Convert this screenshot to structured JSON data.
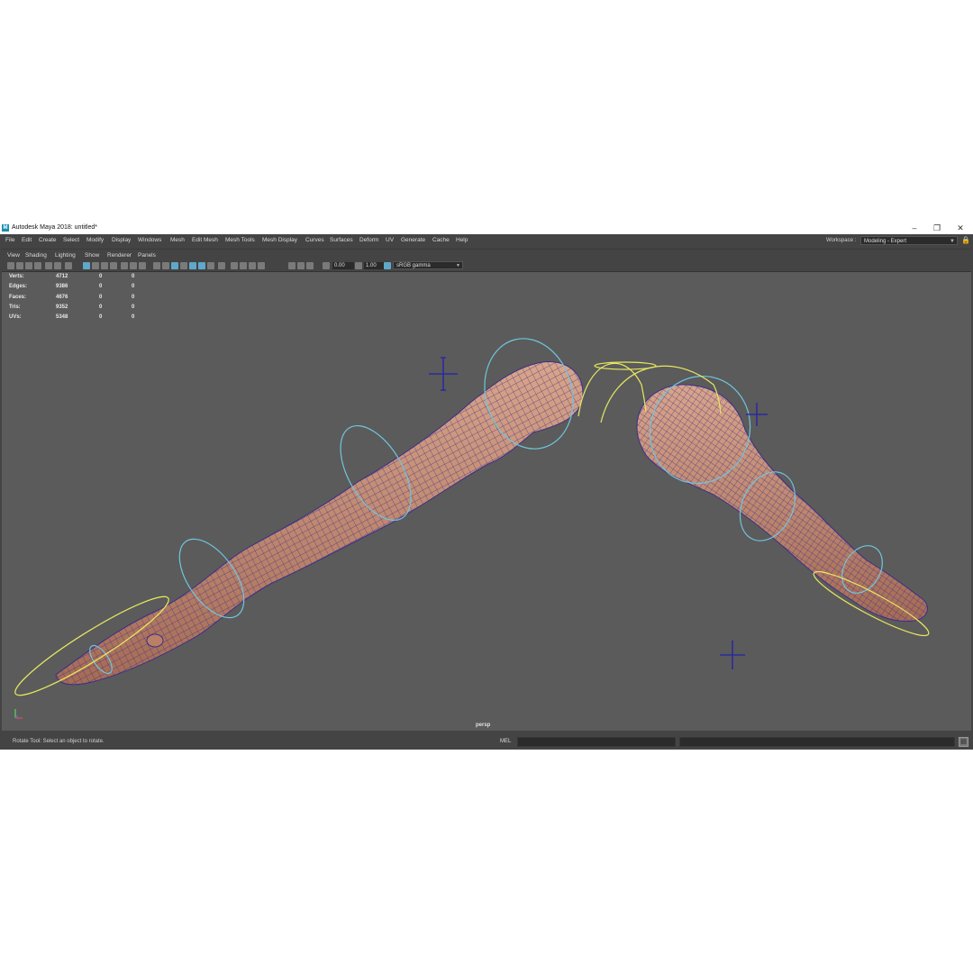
{
  "window": {
    "title": "Autodesk Maya 2018: untitled*",
    "logo_letter": "M",
    "minimize_glyph": "–",
    "restore_glyph": "❐",
    "close_glyph": "✕"
  },
  "menubar": {
    "items": [
      "File",
      "Edit",
      "Create",
      "Select",
      "Modify",
      "Display",
      "Windows",
      "Mesh",
      "Edit Mesh",
      "Mesh Tools",
      "Mesh Display",
      "Curves",
      "Surfaces",
      "Deform",
      "UV",
      "Generate",
      "Cache",
      "Help"
    ]
  },
  "workspace": {
    "label": "Workspace :",
    "value": "Modeling - Expert"
  },
  "panel_menu": {
    "items": [
      "View",
      "Shading",
      "Lighting",
      "Show",
      "Renderer",
      "Panels"
    ]
  },
  "toolbar": {
    "exposure_value": "0.00",
    "gamma_value": "1.00",
    "color_space": "sRGB gamma"
  },
  "hud": {
    "rows": [
      {
        "label": "Verts:",
        "a": "4712",
        "b": "0",
        "c": "0"
      },
      {
        "label": "Edges:",
        "a": "9386",
        "b": "0",
        "c": "0"
      },
      {
        "label": "Faces:",
        "a": "4676",
        "b": "0",
        "c": "0"
      },
      {
        "label": "Tris:",
        "a": "9352",
        "b": "0",
        "c": "0"
      },
      {
        "label": "UVs:",
        "a": "5348",
        "b": "0",
        "c": "0"
      }
    ]
  },
  "viewport": {
    "camera": "persp"
  },
  "statusbar": {
    "help_text": "Rotate Tool: Select an object to rotate.",
    "command_language": "MEL"
  },
  "colors": {
    "skin": "#c48a6e",
    "wire": "#3a2f8a",
    "ctrl_cyan": "#6fc6e0",
    "ctrl_yellow": "#e8e860",
    "locator": "#2a2aa0"
  }
}
